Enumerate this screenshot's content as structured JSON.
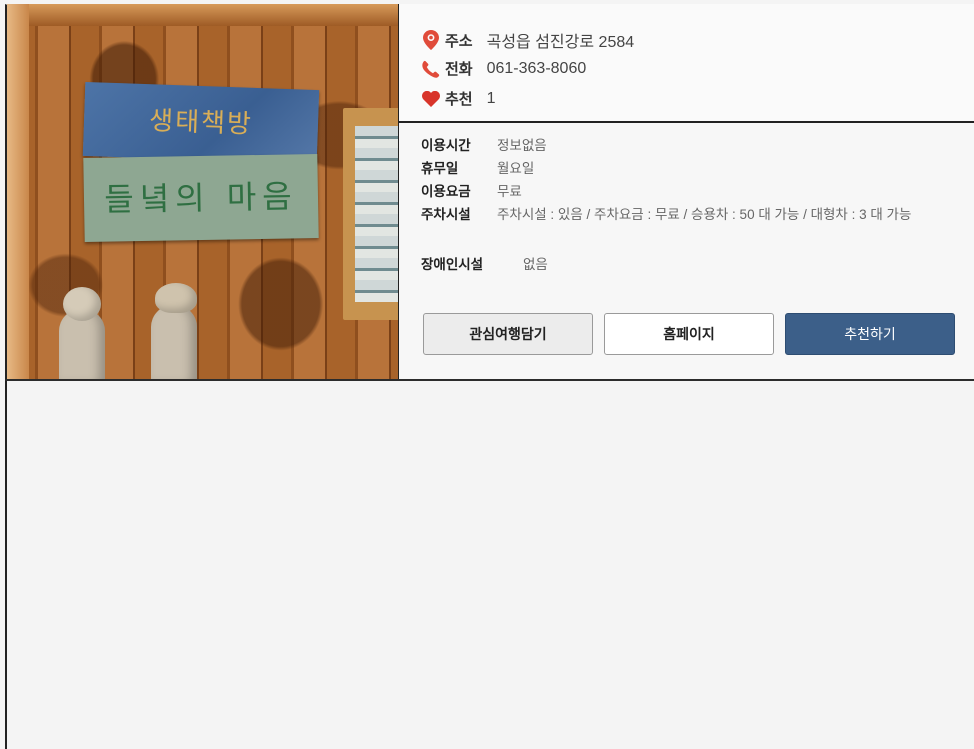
{
  "photo": {
    "sign_top_text": "생태책방",
    "sign_bottom_text": "들녘의 마음"
  },
  "info": {
    "address_label": "주소",
    "address_value": "곡성읍 섬진강로 2584",
    "phone_label": "전화",
    "phone_value": "061-363-8060",
    "recommend_label": "추천",
    "recommend_value": "1",
    "icons": [
      "location-pin-icon",
      "phone-icon",
      "heart-icon"
    ],
    "accent_color": "#e04b3a"
  },
  "details": {
    "hours_label": "이용시간",
    "hours_value": "정보없음",
    "closed_label": "휴무일",
    "closed_value": "월요일",
    "fee_label": "이용요금",
    "fee_value": "무료",
    "parking_label": "주차시설",
    "parking_value": "주차시설 : 있음 / 주차요금 : 무료 / 승용차 : 50 대 가능 / 대형차 : 3 대 가능",
    "accessibility_label": "장애인시설",
    "accessibility_value": "없음"
  },
  "buttons": {
    "favorite_label": "관심여행담기",
    "homepage_label": "홈페이지",
    "recommend_label": "추천하기",
    "recommend_color": "#3c5f89"
  }
}
